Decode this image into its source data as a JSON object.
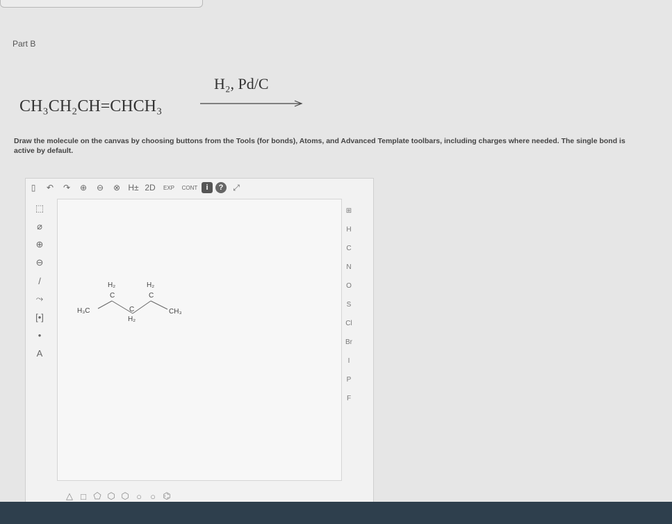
{
  "part_label": "Part B",
  "reaction": {
    "reactant": "CH₃CH₂CH=CHCH₃",
    "reagents": "H₂, Pd/C"
  },
  "instructions": "Draw the molecule on the canvas by choosing buttons from the Tools (for bonds), Atoms, and Advanced Template toolbars, including charges where needed. The single bond is active by default.",
  "toolbar_top": [
    {
      "name": "new-document-icon",
      "glyph": "▯"
    },
    {
      "name": "undo-icon",
      "glyph": "↶"
    },
    {
      "name": "redo-icon",
      "glyph": "↷"
    },
    {
      "name": "zoom-in-icon",
      "glyph": "⊕"
    },
    {
      "name": "zoom-out-icon",
      "glyph": "⊖"
    },
    {
      "name": "zoom-reset-icon",
      "glyph": "⊗"
    },
    {
      "name": "hydrogen-toggle-icon",
      "glyph": "H±"
    },
    {
      "name": "2d-clean-icon",
      "glyph": "2D"
    },
    {
      "name": "expand-icon",
      "glyph": "EXP"
    },
    {
      "name": "contract-icon",
      "glyph": "CONT"
    }
  ],
  "toolbar_left": [
    {
      "name": "select-tool-icon",
      "glyph": "⬚"
    },
    {
      "name": "eraser-icon",
      "glyph": "⌀"
    },
    {
      "name": "positive-charge-icon",
      "glyph": "⊕"
    },
    {
      "name": "negative-charge-icon",
      "glyph": "⊖"
    },
    {
      "name": "single-bond-icon",
      "glyph": "/"
    },
    {
      "name": "chain-tool-icon",
      "glyph": "⤳"
    },
    {
      "name": "bracket-tool-icon",
      "glyph": "[•]"
    },
    {
      "name": "lone-pair-icon",
      "glyph": "•"
    },
    {
      "name": "atom-label-icon",
      "glyph": "A"
    }
  ],
  "atoms": [
    "H",
    "C",
    "N",
    "O",
    "S",
    "Cl",
    "Br",
    "I",
    "P",
    "F"
  ],
  "periodic_table_glyph": "⊞",
  "toolbar_bottom": [
    {
      "name": "triangle-template-icon",
      "glyph": "△"
    },
    {
      "name": "square-template-icon",
      "glyph": "□"
    },
    {
      "name": "pentagon-template-icon",
      "glyph": "⬠"
    },
    {
      "name": "hexagon-template-icon",
      "glyph": "⬡"
    },
    {
      "name": "hexagon-alt-template-icon",
      "glyph": "⬡"
    },
    {
      "name": "heptagon-template-icon",
      "glyph": "○"
    },
    {
      "name": "octagon-template-icon",
      "glyph": "○"
    },
    {
      "name": "benzene-template-icon",
      "glyph": "⌬"
    }
  ],
  "molecule_labels": {
    "h3c": "H₃C",
    "ch3": "CH₃",
    "h2_top1": "H₂",
    "c_top1": "C",
    "h2_top2": "H₂",
    "c_top2": "C",
    "c_bottom": "C",
    "h2_bottom": "H₂"
  }
}
